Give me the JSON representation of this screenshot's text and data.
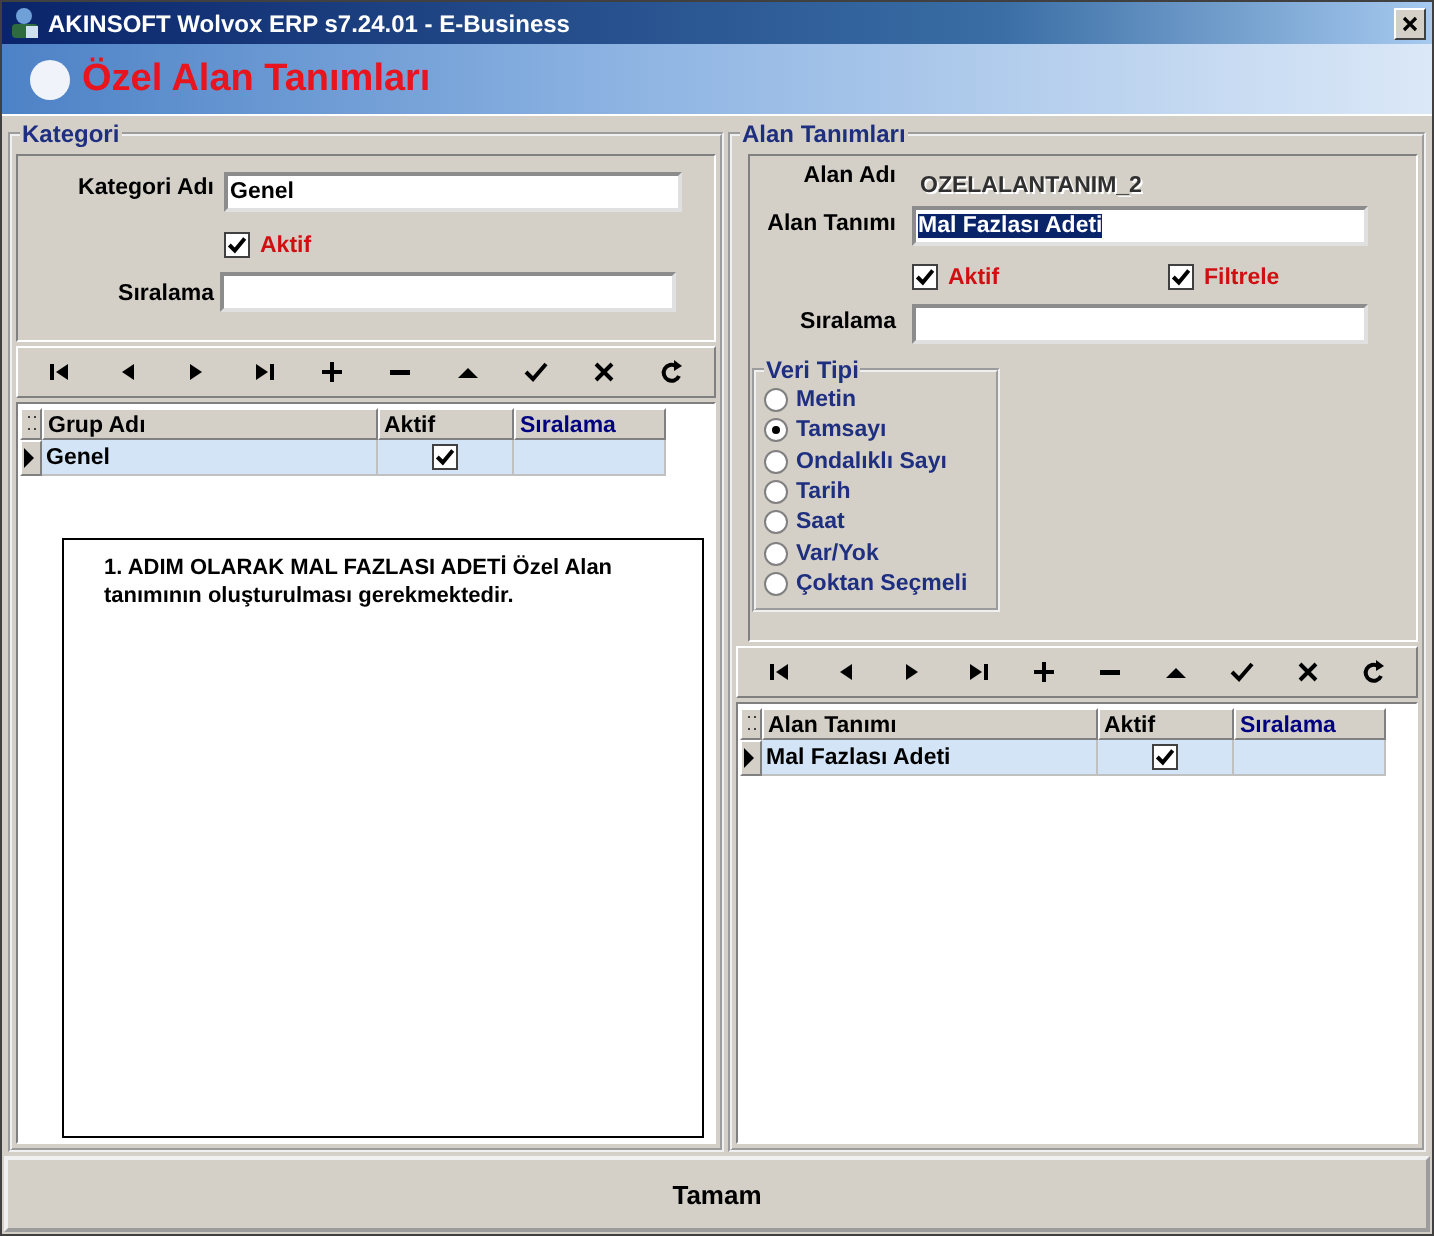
{
  "window": {
    "title": "AKINSOFT Wolvox ERP s7.24.01 - E-Business"
  },
  "header": {
    "title": "Özel Alan Tanımları"
  },
  "kategori": {
    "group_title": "Kategori",
    "name_label": "Kategori Adı",
    "name_value": "Genel",
    "aktif": {
      "label": "Aktif",
      "checked": true
    },
    "siralama_label": "Sıralama",
    "grid": {
      "columns": [
        "Grup Adı",
        "Aktif",
        "Sıralama"
      ],
      "rows": [
        {
          "name": "Genel",
          "aktif": true,
          "selected": true
        }
      ]
    },
    "note": "1. ADIM OLARAK MAL FAZLASI ADETİ Özel Alan tanımının oluşturulması gerekmektedir."
  },
  "alan": {
    "group_title": "Alan Tanımları",
    "alan_adi_label": "Alan Adı",
    "alan_adi_value": "OZELALANTANIM_2",
    "tanim_label": "Alan Tanımı",
    "tanim_value": "Mal Fazlası Adeti",
    "tanim_text_selected": true,
    "checkboxes": [
      {
        "label": "Aktif",
        "checked": true
      },
      {
        "label": "Filtrele",
        "checked": true
      }
    ],
    "siralama_label": "Sıralama",
    "veri_tipi": {
      "title": "Veri Tipi",
      "options": [
        {
          "label": "Metin",
          "selected": false
        },
        {
          "label": "Tamsayı",
          "selected": true
        },
        {
          "label": "Ondalıklı Sayı",
          "selected": false
        },
        {
          "label": "Tarih",
          "selected": false
        },
        {
          "label": "Saat",
          "selected": false
        },
        {
          "label": "Var/Yok",
          "selected": false
        },
        {
          "label": "Çoktan Seçmeli",
          "selected": false
        }
      ]
    },
    "grid": {
      "columns": [
        "Alan Tanımı",
        "Aktif",
        "Sıralama"
      ],
      "rows": [
        {
          "name": "Mal Fazlası Adeti",
          "aktif": true,
          "selected": true
        }
      ]
    }
  },
  "ok_button": "Tamam"
}
